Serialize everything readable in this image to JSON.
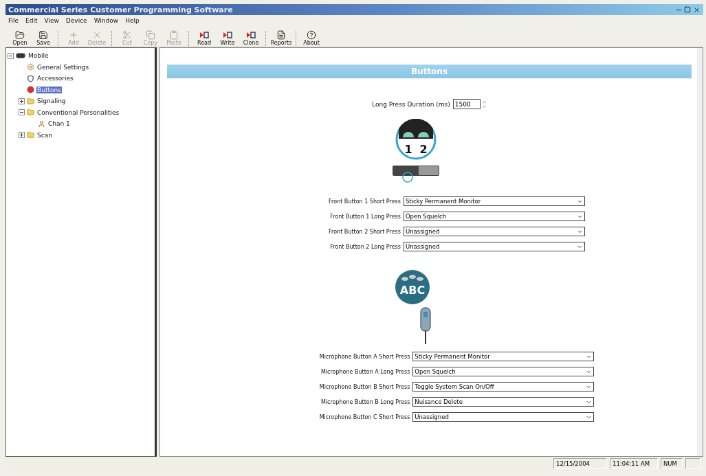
{
  "window": {
    "title": "Commercial Series Customer Programming Software"
  },
  "menu": [
    "File",
    "Edit",
    "View",
    "Device",
    "Window",
    "Help"
  ],
  "toolbar_groups": [
    {
      "items": [
        {
          "label": "Open",
          "kind": "open",
          "disabled": false
        },
        {
          "label": "Save",
          "kind": "save",
          "disabled": false
        }
      ]
    },
    {
      "items": [
        {
          "label": "Add",
          "kind": "add",
          "disabled": true
        },
        {
          "label": "Delete",
          "kind": "delete",
          "disabled": true
        }
      ]
    },
    {
      "items": [
        {
          "label": "Cut",
          "kind": "cut",
          "disabled": true
        },
        {
          "label": "Copy",
          "kind": "copy",
          "disabled": true
        },
        {
          "label": "Paste",
          "kind": "paste",
          "disabled": true
        }
      ]
    },
    {
      "items": [
        {
          "label": "Read",
          "kind": "read",
          "disabled": false
        },
        {
          "label": "Write",
          "kind": "write",
          "disabled": false
        },
        {
          "label": "Clone",
          "kind": "clone",
          "disabled": false
        }
      ]
    },
    {
      "items": [
        {
          "label": "Reports",
          "kind": "reports",
          "disabled": false
        }
      ]
    },
    {
      "items": [
        {
          "label": "About",
          "kind": "about",
          "disabled": false
        }
      ]
    }
  ],
  "tree": [
    {
      "label": "Mobile",
      "kind": "radio",
      "expanded": true,
      "selected": false,
      "children": [
        {
          "label": "General Settings",
          "kind": "settings",
          "selected": false
        },
        {
          "label": "Accessories",
          "kind": "accessory",
          "selected": false
        },
        {
          "label": "Buttons",
          "kind": "buttons",
          "selected": true
        },
        {
          "label": "Signaling",
          "kind": "folder",
          "expanded": false,
          "selected": false
        },
        {
          "label": "Conventional Personalities",
          "kind": "personalities",
          "expanded": true,
          "selected": false,
          "children": [
            {
              "label": "Chan 1",
              "kind": "channel",
              "selected": false
            }
          ]
        },
        {
          "label": "Scan",
          "kind": "scan",
          "expanded": false,
          "selected": false
        }
      ]
    }
  ],
  "panel": {
    "title": "Buttons",
    "long_press": {
      "label": "Long Press Duration (ms)",
      "value": "1500"
    },
    "front_graphic": {
      "labels": [
        "1",
        "2"
      ]
    },
    "front_buttons": [
      {
        "label": "Front Button 1 Short Press",
        "value": "Sticky Permanent Monitor"
      },
      {
        "label": "Front Button 1 Long Press",
        "value": "Open Squelch"
      },
      {
        "label": "Front Button 2 Short Press",
        "value": "Unassigned"
      },
      {
        "label": "Front Button 2 Long Press",
        "value": "Unassigned"
      }
    ],
    "mic_graphic": {
      "label": "ABC"
    },
    "mic_buttons": [
      {
        "label": "Microphone Button A Short Press",
        "value": "Sticky Permanent Monitor"
      },
      {
        "label": "Microphone Button A Long Press",
        "value": "Open Squelch"
      },
      {
        "label": "Microphone Button B Short Press",
        "value": "Toggle System Scan On/Off"
      },
      {
        "label": "Microphone Button B Long Press",
        "value": "Nuisance Delete"
      },
      {
        "label": "Microphone Button C Short Press",
        "value": "Unassigned"
      }
    ]
  },
  "status_bar": {
    "date": "12/15/2004",
    "time": "11:04:11 AM",
    "num": "NUM"
  }
}
